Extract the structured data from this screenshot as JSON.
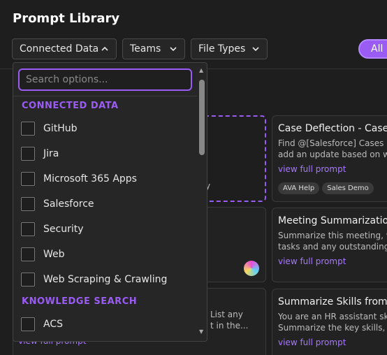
{
  "page": {
    "title": "Prompt Library"
  },
  "filters": {
    "connected_data": "Connected Data",
    "teams": "Teams",
    "file_types": "File Types",
    "all": "All"
  },
  "dropdown": {
    "search_placeholder": "Search options...",
    "groups": [
      {
        "header": "CONNECTED DATA",
        "options": [
          "GitHub",
          "Jira",
          "Microsoft 365 Apps",
          "Salesforce",
          "Security",
          "Web",
          "Web Scraping & Crawling"
        ]
      },
      {
        "header": "KNOWLEDGE SEARCH",
        "options": [
          "ACS"
        ]
      }
    ]
  },
  "cards": [
    {
      "title": "Case Deflection - Case R",
      "desc1": "Find @[Salesforce] Cases ma",
      "desc2": "add an update based on wh",
      "link": "view full prompt",
      "tags": [
        "AVA Help",
        "Sales Demo"
      ]
    },
    {
      "title": "Meeting Summarization",
      "desc1": "Summarize this meeting, wi",
      "desc2": "tasks and any outstanding f",
      "link": "view full prompt"
    },
    {
      "title": "Summarize Skills from R",
      "desc1": "You are an HR assistant skill",
      "desc2": "Summarize the key skills, ce",
      "link": "view full prompt"
    }
  ],
  "left_cards": {
    "partial_text_1": "y",
    "partial_text_2": "List any",
    "partial_text_3": "t in the...",
    "partial_link": "view full prompt"
  },
  "colors": {
    "accent": "#9b5cf6",
    "background": "#1e1e1e"
  }
}
